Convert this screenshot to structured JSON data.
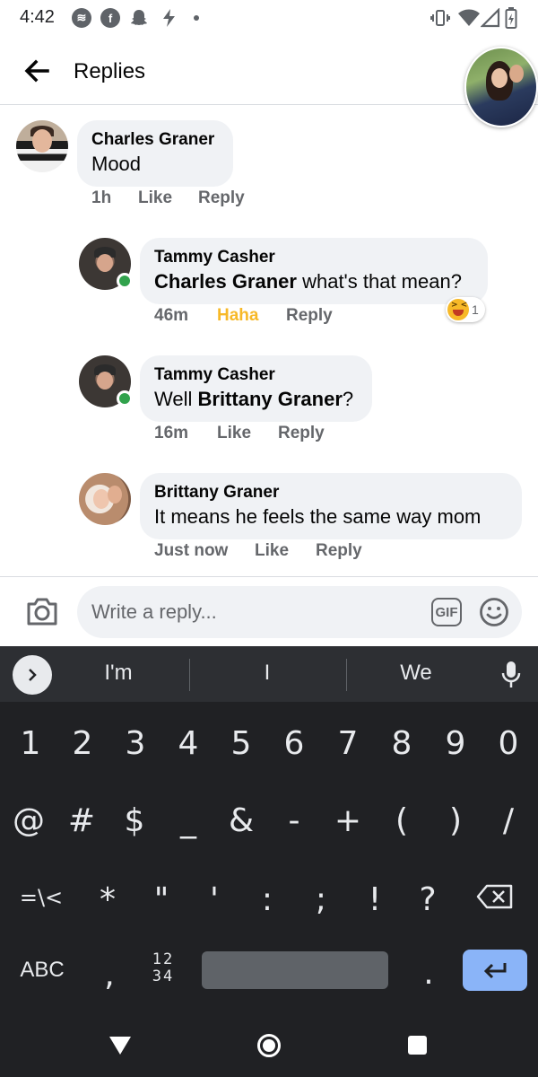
{
  "status_bar": {
    "time": "4:42",
    "left_icons": [
      "spotify-icon",
      "facebook-icon",
      "snapchat-icon",
      "flash-icon"
    ],
    "right_icons": [
      "vibrate-icon",
      "wifi-icon",
      "cell-signal-icon",
      "battery-icon"
    ]
  },
  "header": {
    "title": "Replies"
  },
  "comments": [
    {
      "author": "Charles Graner",
      "text": "Mood",
      "time": "1h",
      "actions": [
        "Like",
        "Reply"
      ]
    },
    {
      "author": "Tammy Casher",
      "mention": "Charles Graner",
      "text_after": " what's that mean?",
      "time": "46m",
      "actions": [
        "Haha",
        "Reply"
      ],
      "reaction_count": "1",
      "online": true
    },
    {
      "author": "Tammy Casher",
      "text_before": "Well ",
      "mention": "Brittany Graner",
      "text_after": "?",
      "time": "16m",
      "actions": [
        "Like",
        "Reply"
      ],
      "online": true
    },
    {
      "author": "Brittany Graner",
      "text": "It means he feels the same way mom",
      "time": "Just now",
      "actions": [
        "Like",
        "Reply"
      ]
    }
  ],
  "composer": {
    "placeholder": "Write a reply...",
    "gif_label": "GIF"
  },
  "keyboard": {
    "suggestions": [
      "I'm",
      "I",
      "We"
    ],
    "row_numbers": [
      "1",
      "2",
      "3",
      "4",
      "5",
      "6",
      "7",
      "8",
      "9",
      "0"
    ],
    "row_symbols1": [
      "@",
      "#",
      "$",
      "_",
      "&",
      "-",
      "+",
      "(",
      ")",
      "/"
    ],
    "row_symbols2": [
      "=\\<",
      "*",
      "\"",
      "'",
      ":",
      ";",
      "!",
      "?"
    ],
    "abc_label": "ABC",
    "comma": ",",
    "num_top": "12",
    "num_bottom": "34",
    "period": "."
  },
  "colors": {
    "accent_haha": "#f7b928",
    "online": "#31a24c",
    "enter_key": "#8ab4f8",
    "keyboard_bg": "#202124"
  }
}
